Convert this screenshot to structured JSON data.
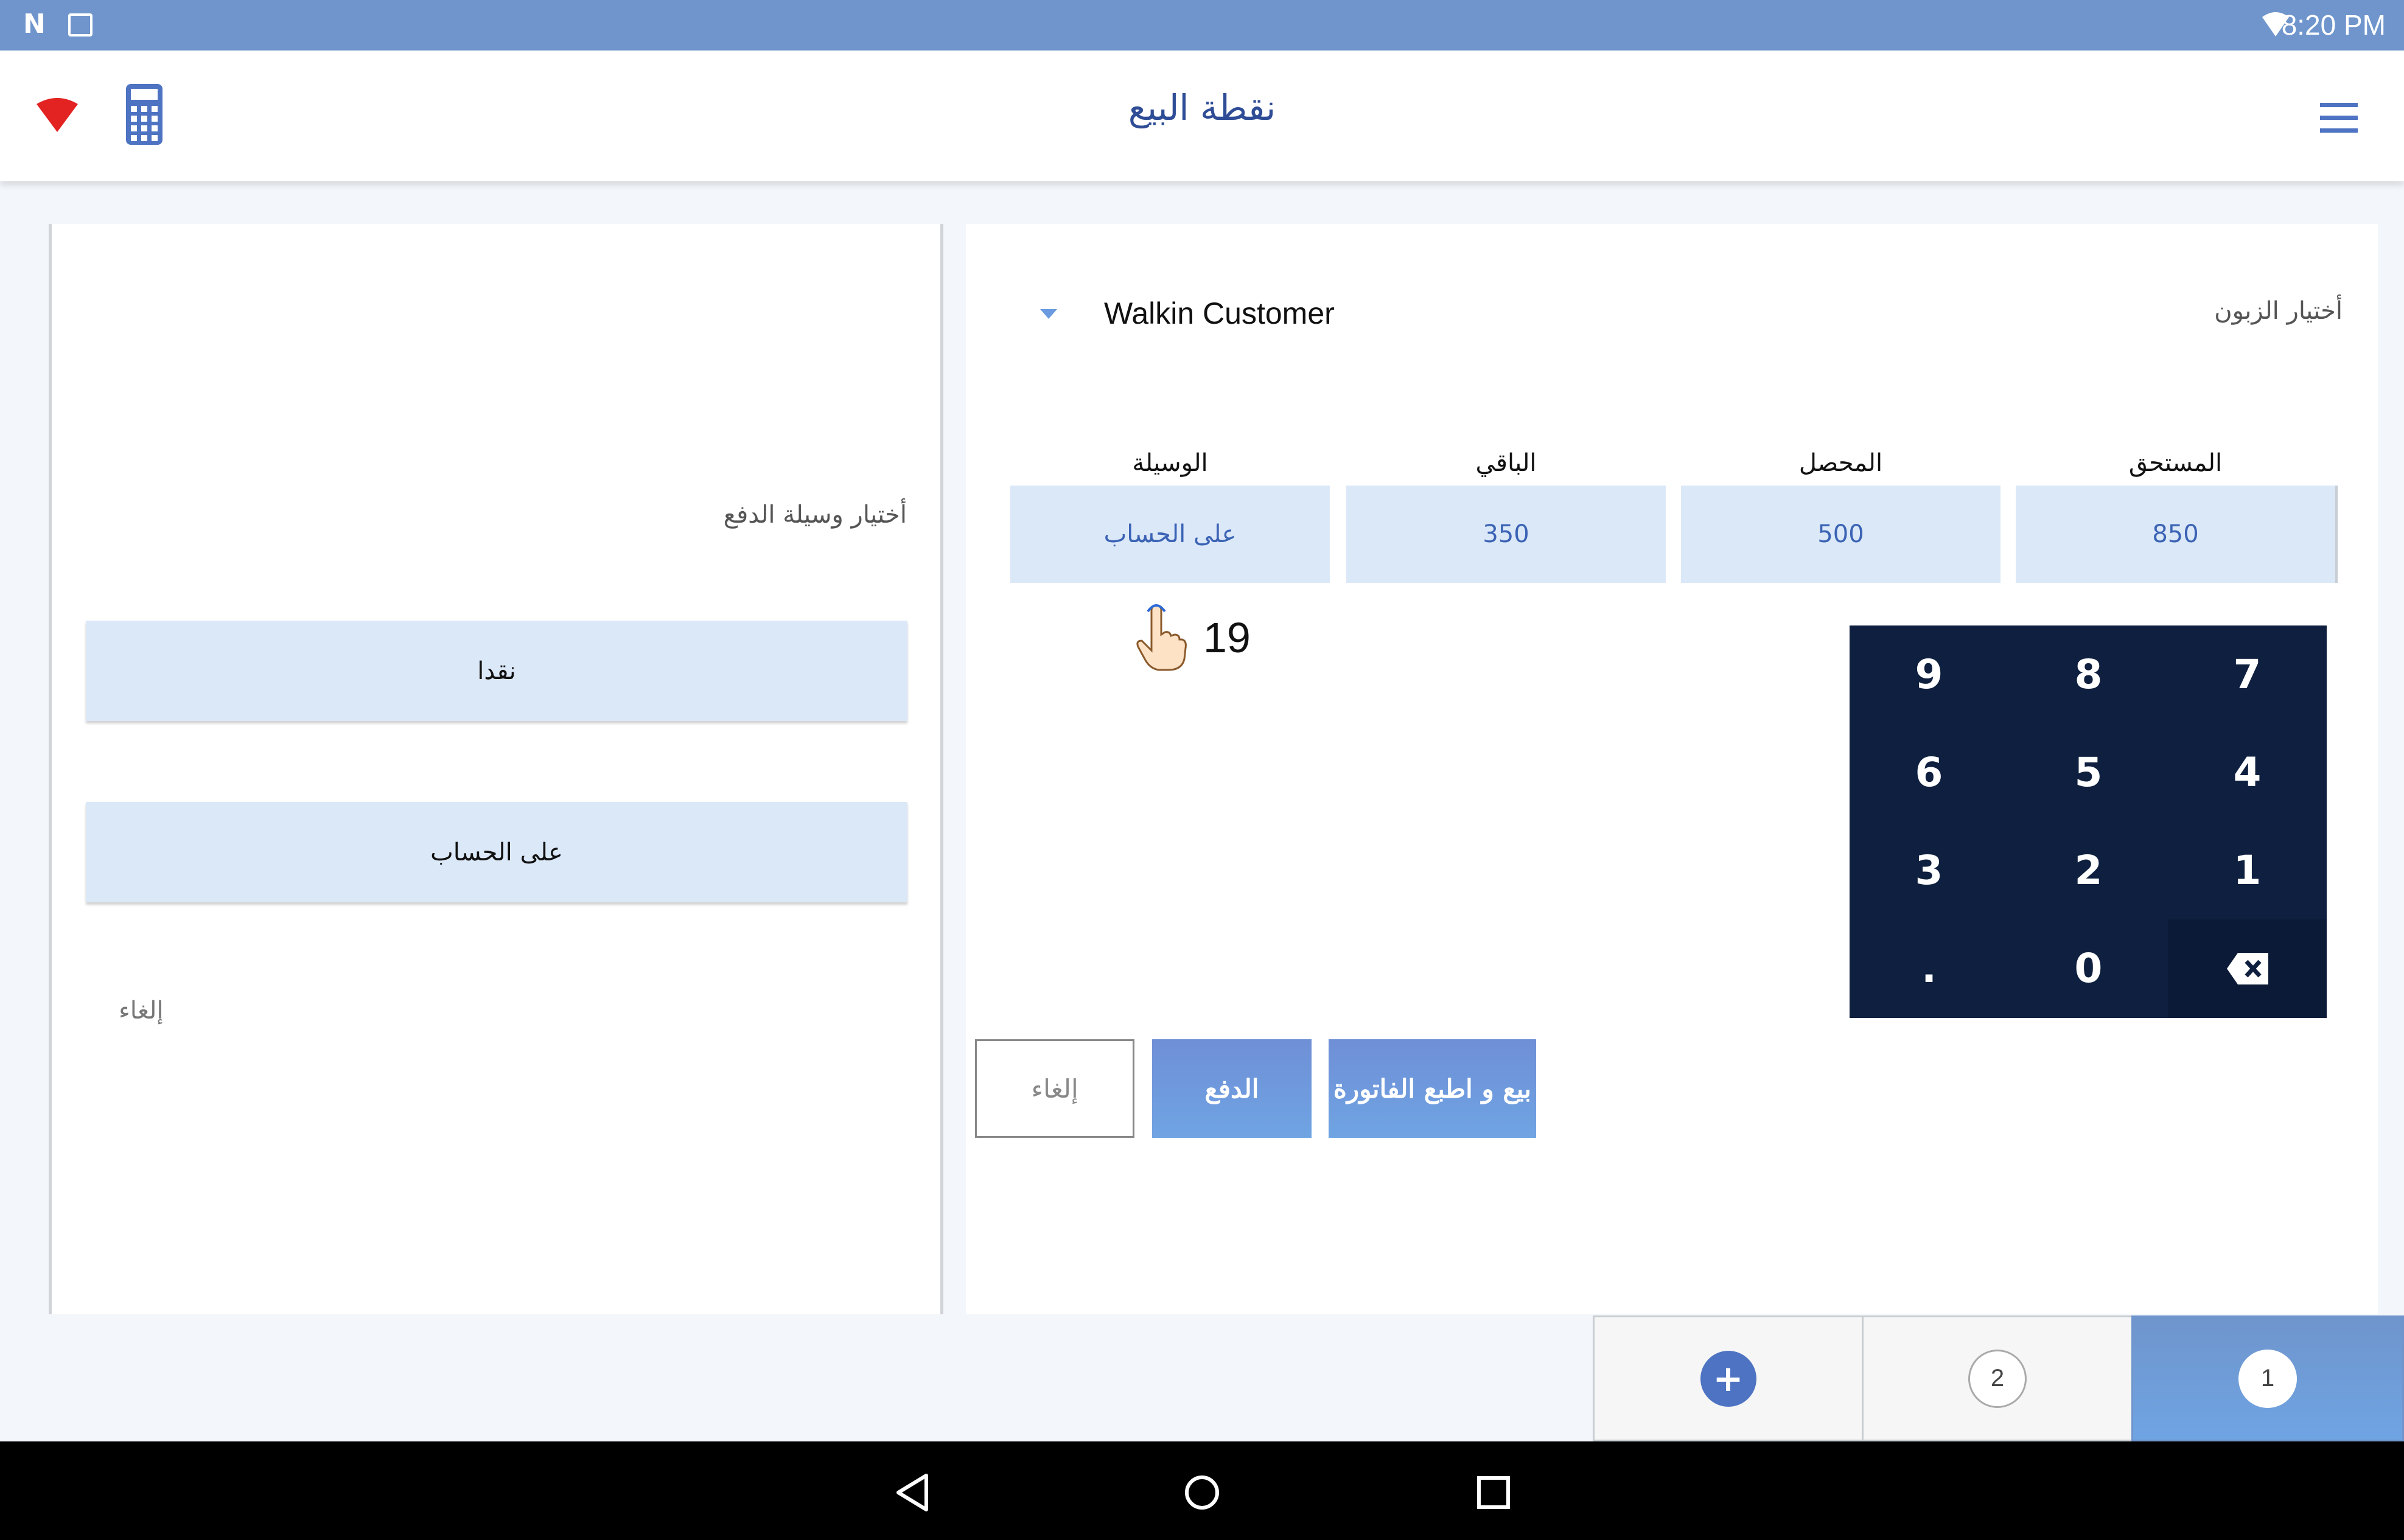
{
  "status_bar": {
    "time": "8:20 PM"
  },
  "app_bar": {
    "title": "نقطة البيع"
  },
  "left_panel": {
    "payment_method_label": "أختيار وسيلة الدفع",
    "buttons": [
      "نقدا",
      "على الحساب"
    ],
    "cancel_label": "إلغاء"
  },
  "right_panel": {
    "customer_label": "أختيار الزبون",
    "customer_value": "Walkin Customer",
    "columns": [
      {
        "header": "المستحق",
        "value": "850"
      },
      {
        "header": "المحصل",
        "value": "500"
      },
      {
        "header": "الباقي",
        "value": "350"
      },
      {
        "header": "الوسيلة",
        "value": "على الحساب"
      }
    ],
    "touch_count": "19",
    "numpad_keys": [
      "7",
      "8",
      "9",
      "4",
      "5",
      "6",
      "1",
      "2",
      "3",
      "backspace",
      "0",
      "."
    ],
    "actions": {
      "sell_print": "بيع و اطبع الفاتورة",
      "pay": "الدفع",
      "cancel": "إلغاء"
    }
  },
  "tabs": {
    "tab1": "1",
    "tab2": "2",
    "add": "+"
  },
  "colors": {
    "accent": "#6f95cc",
    "numpad_bg": "#0e1f3f",
    "box_bg": "#dbe8f8"
  }
}
